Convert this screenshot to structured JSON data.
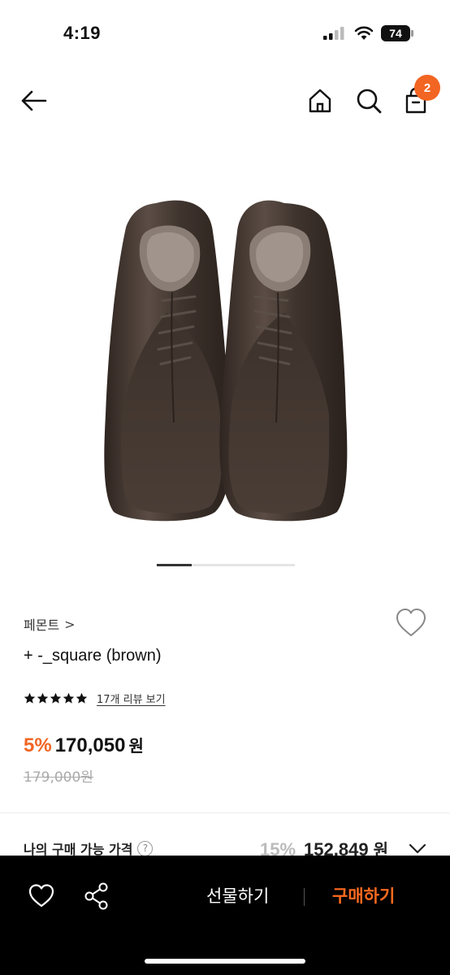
{
  "status_bar": {
    "time": "4:19",
    "battery": "74"
  },
  "nav": {
    "cart_count": "2"
  },
  "product": {
    "brand": "페몬트",
    "brand_chevron": ">",
    "name": "+ -_square (brown)",
    "rating_stars": 5,
    "review_link": "17개 리뷰 보기",
    "discount": "5%",
    "price": "170,050",
    "price_unit": "원",
    "original_price": "179,000원",
    "image_count": 4,
    "current_image": 1
  },
  "my_price": {
    "label": "나의 구매 가능 가격",
    "help": "?",
    "discount": "15%",
    "price": "152,849",
    "unit": "원"
  },
  "bottom_bar": {
    "gift_label": "선물하기",
    "buy_label": "구매하기"
  },
  "colors": {
    "accent": "#f26522",
    "buy": "#ff6a1f",
    "bar": "#000000"
  }
}
